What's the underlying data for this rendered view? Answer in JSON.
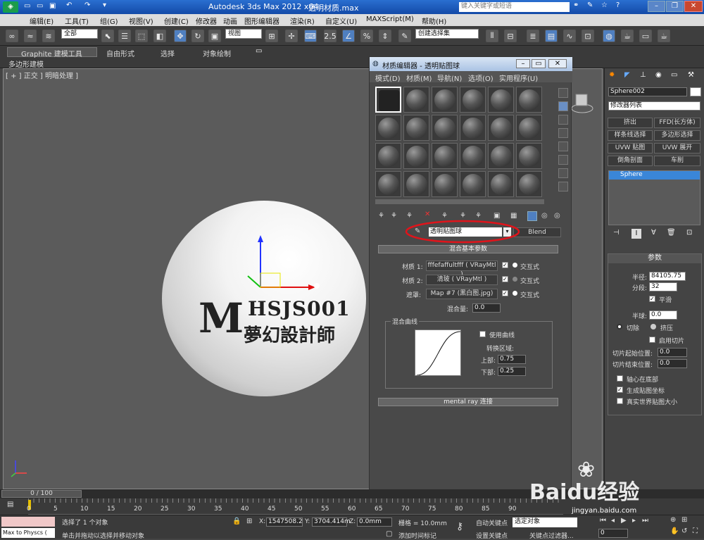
{
  "window": {
    "app_title": "Autodesk 3ds Max  2012 x64",
    "file_title": "透明材质.max",
    "search_placeholder": "键入关键字或短语"
  },
  "menubar": [
    "编辑(E)",
    "工具(T)",
    "组(G)",
    "视图(V)",
    "创建(C)",
    "修改器",
    "动画",
    "图形编辑器",
    "渲染(R)",
    "自定义(U)",
    "MAXScript(M)",
    "帮助(H)"
  ],
  "toolbar": {
    "selection_filter": "全部",
    "coord_system": "视图",
    "named_selection": "创建选择集",
    "snap_angle": "2.5"
  },
  "ribbon": {
    "tabs": [
      "Graphite 建模工具",
      "自由形式",
      "选择",
      "对象绘制"
    ],
    "subtab": "多边形建模"
  },
  "viewport": {
    "label": "[ + ] 正交 ] 明暗处理 ]",
    "logo_m": "M",
    "logo_line1": "HSJS001",
    "logo_line2": "夢幻設計師"
  },
  "material_editor": {
    "title": "材质编辑器 - 透明贴图球",
    "menu": [
      "模式(D)",
      "材质(M)",
      "导航(N)",
      "选项(O)",
      "实用程序(U)"
    ],
    "material_name": "透明贴图球",
    "material_type": "Blend",
    "blend_rollout_title": "混合基本参数",
    "material1_label": "材质 1:",
    "material1_value": "fffefaffultfff ( VRayMtl )",
    "material2_label": "材质 2:",
    "material2_value": "清玻 ( VRayMtl )",
    "mask_label": "遮罩:",
    "mask_value": "Map #7 (黑白图.jpg)",
    "interactive_label": "交互式",
    "mix_amount_label": "混合量:",
    "mix_amount_value": "0.0",
    "mix_curve_group": "混合曲线",
    "use_curve_label": "使用曲线",
    "transition_zone_label": "转换区域:",
    "upper_label": "上部:",
    "upper_value": "0.75",
    "lower_label": "下部:",
    "lower_value": "0.25",
    "mental_ray_rollout": "mental ray 连接"
  },
  "command_panel": {
    "object_name": "Sphere002",
    "modifier_list": "修改器列表",
    "modifier_buttons": [
      "挤出",
      "FFD(长方体)",
      "样条线选择",
      "多边形选择",
      "UVW 贴图",
      "UVW 展开",
      "倒角剖面",
      "车削"
    ],
    "stack_item": "Sphere",
    "params_title": "参数",
    "radius_label": "半径:",
    "radius_value": "84105.75",
    "segments_label": "分段:",
    "segments_value": "32",
    "smooth_label": "平滑",
    "hemisphere_label": "半球:",
    "hemisphere_value": "0.0",
    "chop_label": "切除",
    "squash_label": "挤压",
    "slice_on_label": "启用切片",
    "slice_from_label": "切片起始位置:",
    "slice_from_value": "0.0",
    "slice_to_label": "切片结束位置:",
    "slice_to_value": "0.0",
    "base_to_pivot_label": "轴心在底部",
    "gen_mapping_label": "生成贴图坐标",
    "real_world_label": "真实世界贴图大小"
  },
  "timeline": {
    "frame_counter": "0 / 100",
    "ticks": [
      "0",
      "5",
      "10",
      "15",
      "20",
      "25",
      "30",
      "35",
      "40",
      "45",
      "50",
      "55",
      "60",
      "65",
      "70",
      "75",
      "80",
      "85",
      "90"
    ]
  },
  "status": {
    "script_listener": "Max to Physcs (",
    "selected_text": "选择了 1 个对象",
    "prompt_text": "单击并拖动以选择并移动对象",
    "x_label": "X:",
    "x_value": "1547508.2",
    "y_label": "Y:",
    "y_value": "3704.414m",
    "z_label": "Z:",
    "z_value": "0.0mm",
    "grid": "栅格 = 10.0mm",
    "add_time_tag": "添加时间标记",
    "auto_key": "自动关键点",
    "set_key": "设置关键点",
    "selected_set": "选定对象",
    "key_filters": "关键点过滤器...",
    "frame_value": "0"
  },
  "watermark": {
    "brand": "Baidu经验",
    "url": "jingyan.baidu.com"
  },
  "colors": {
    "title_blue": "#134aa8",
    "annotation_red": "#e0141b",
    "stack_highlight": "#3a86d8"
  }
}
